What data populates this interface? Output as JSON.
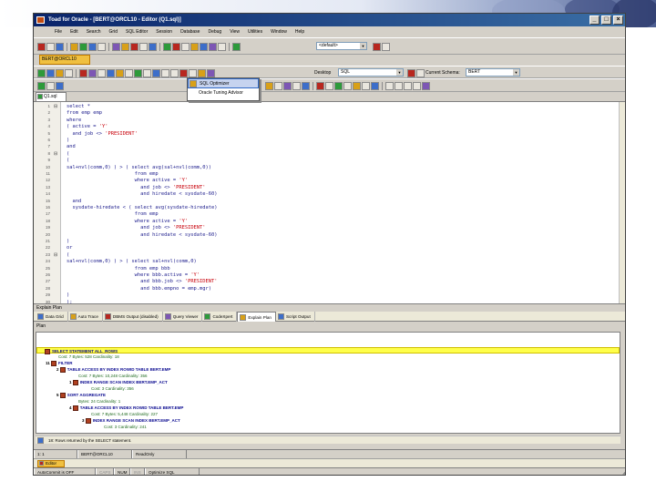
{
  "window": {
    "title": "Toad for Oracle - [BERT@ORCL10 - Editor (Q1.sql)]",
    "min": "_",
    "max": "□",
    "close": "×"
  },
  "menu": [
    "File",
    "Edit",
    "Search",
    "Grid",
    "SQL Editor",
    "Session",
    "Database",
    "Debug",
    "View",
    "Utilities",
    "Window",
    "Help"
  ],
  "connection": {
    "tab": "BERT@ORCL10",
    "schema_combo": "<default>"
  },
  "toolbar2": {
    "desktop_label": "Desktop",
    "desktop_value": "SQL",
    "schema_label": "Current Schema:",
    "schema_value": "BERT"
  },
  "dropdown": {
    "items": [
      "SQL Optimizer",
      "Oracle Tuning Advisor"
    ]
  },
  "doc_tab": "Q1.sql",
  "editor": {
    "lines": [
      {
        "n": "1",
        "fold": "⊟",
        "code": "select *"
      },
      {
        "n": "2",
        "fold": "",
        "code": "from emp emp"
      },
      {
        "n": "3",
        "fold": "",
        "code": "where"
      },
      {
        "n": "4",
        "fold": "",
        "code": "( active = ",
        "str": "'Y'"
      },
      {
        "n": "5",
        "fold": "",
        "code": "  and job <> ",
        "str": "'PRESIDENT'"
      },
      {
        "n": "6",
        "fold": "",
        "code": ")"
      },
      {
        "n": "7",
        "fold": "",
        "code": "and"
      },
      {
        "n": "8",
        "fold": "⊟",
        "code": "("
      },
      {
        "n": "9",
        "fold": "",
        "code": "("
      },
      {
        "n": "10",
        "fold": "",
        "code": "sal+nvl(comm,0) ) > ( select avg(sal+nvl(comm,0))"
      },
      {
        "n": "11",
        "fold": "",
        "code": "                       from emp"
      },
      {
        "n": "12",
        "fold": "",
        "code": "                       where active = ",
        "str": "'Y'"
      },
      {
        "n": "13",
        "fold": "",
        "code": "                         and job <> ",
        "str": "'PRESIDENT'"
      },
      {
        "n": "14",
        "fold": "",
        "code": "                         and hiredate < sysdate-60)"
      },
      {
        "n": "15",
        "fold": "",
        "code": "  and"
      },
      {
        "n": "16",
        "fold": "",
        "code": "  sysdate-hiredate < ( select avg(sysdate-hiredate)"
      },
      {
        "n": "17",
        "fold": "",
        "code": "                       from emp"
      },
      {
        "n": "18",
        "fold": "",
        "code": "                       where active = ",
        "str": "'Y'"
      },
      {
        "n": "19",
        "fold": "",
        "code": "                         and job <> ",
        "str": "'PRESIDENT'"
      },
      {
        "n": "20",
        "fold": "",
        "code": "                         and hiredate < sysdate-60)"
      },
      {
        "n": "21",
        "fold": "",
        "code": ")"
      },
      {
        "n": "22",
        "fold": "",
        "code": "or"
      },
      {
        "n": "23",
        "fold": "⊟",
        "code": "("
      },
      {
        "n": "24",
        "fold": "",
        "code": "sal+nvl(comm,0) ) > ( select sal+nvl(comm,0)"
      },
      {
        "n": "25",
        "fold": "",
        "code": "                       from emp bbb"
      },
      {
        "n": "26",
        "fold": "",
        "code": "                       where bbb.active = ",
        "str": "'Y'"
      },
      {
        "n": "27",
        "fold": "",
        "code": "                         and bbb.job <> ",
        "str": "'PRESIDENT'"
      },
      {
        "n": "28",
        "fold": "",
        "code": "                         and bbb.empno = emp.mgr)"
      },
      {
        "n": "29",
        "fold": "",
        "code": ")"
      },
      {
        "n": "30",
        "fold": "",
        "code": ");"
      }
    ]
  },
  "explain": {
    "title": "Explain Plan",
    "tabs": [
      "Data Grid",
      "Auto Trace",
      "DBMS Output (disabled)",
      "Query Viewer",
      "CodeXpert",
      "Explain Plan",
      "Script Output"
    ],
    "plan_label": "Plan",
    "rows": [
      {
        "num": "",
        "text": "SELECT STATEMENT  ALL_ROWS",
        "detail": "Cost: 7  Bytes: 528  Cardinality: 18"
      },
      {
        "num": "11",
        "text": "FILTER",
        "detail": ""
      },
      {
        "num": "2",
        "text": "TABLE ACCESS BY INDEX ROWID TABLE BERT.EMP",
        "detail": "Cost: 7  Bytes: 10,248  Cardinality: 356"
      },
      {
        "num": "1",
        "text": "INDEX RANGE SCAN INDEX BERT.EMP_ACT",
        "detail": "Cost: 3  Cardinality: 356"
      },
      {
        "num": "5",
        "text": "SORT AGGREGATE",
        "detail": "Bytes: 24  Cardinality: 1"
      },
      {
        "num": "4",
        "text": "TABLE ACCESS BY INDEX ROWID TABLE BERT.EMP",
        "detail": "Cost: 7  Bytes: 5,448  Cardinality: 227"
      },
      {
        "num": "3",
        "text": "INDEX RANGE SCAN INDEX BERT.EMP_ACT",
        "detail": "Cost: 3  Cardinality: 241"
      }
    ],
    "message": "18: Rows returned by the SELECT statement."
  },
  "status1": [
    "1: 1",
    "BERT@ORCL10",
    "ReadOnly"
  ],
  "taskbar": {
    "btn": "Editor"
  },
  "status2": [
    "AutoCommit is OFF",
    "CAPS",
    "NUM",
    "INS",
    "Optimize SQL"
  ]
}
